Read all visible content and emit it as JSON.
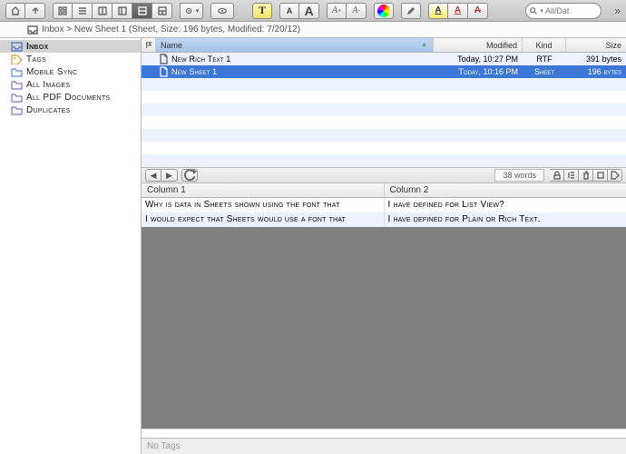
{
  "toolbar": {
    "search_placeholder": "All/Dat"
  },
  "breadcrumb": {
    "text": "Inbox > New Sheet 1 (Sheet, Size: 196 bytes, Modified: 7/20/12)"
  },
  "sidebar": {
    "items": [
      {
        "label": "Inbox",
        "icon": "inbox",
        "selected": true
      },
      {
        "label": "Tags",
        "icon": "tag",
        "selected": false
      },
      {
        "label": "Mobile Sync",
        "icon": "folder",
        "selected": false
      },
      {
        "label": "All Images",
        "icon": "smart",
        "selected": false
      },
      {
        "label": "All PDF Documents",
        "icon": "smart",
        "selected": false
      },
      {
        "label": "Duplicates",
        "icon": "smart",
        "selected": false
      }
    ]
  },
  "filelist": {
    "columns": {
      "name": "Name",
      "modified": "Modified",
      "kind": "Kind",
      "size": "Size"
    },
    "rows": [
      {
        "name": "New Rich Text 1",
        "modified": "Today, 10:27 PM",
        "kind": "RTF",
        "size": "391 bytes",
        "selected": false
      },
      {
        "name": "New Sheet 1",
        "modified": "Today, 10:16 PM",
        "kind": "Sheet",
        "size": "196 bytes",
        "selected": true
      }
    ]
  },
  "midstrip": {
    "word_count": "38 words"
  },
  "sheet": {
    "columns": [
      "Column 1",
      "Column 2"
    ],
    "rows": [
      [
        "Why is data in Sheets shown using the font that",
        "I have defined for List View?"
      ],
      [
        "I would expect that Sheets would use a font that",
        "I have defined for Plain or Rich Text."
      ]
    ]
  },
  "tagbar": {
    "placeholder": "No Tags"
  }
}
